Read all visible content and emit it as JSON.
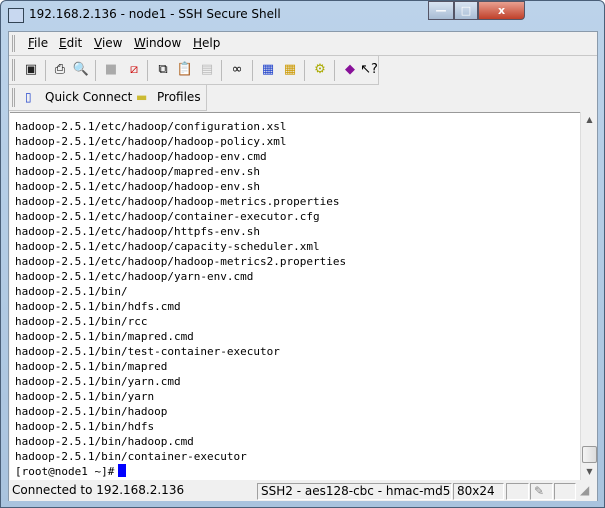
{
  "window": {
    "title": "192.168.2.136 - node1 - SSH Secure Shell",
    "minimize": "—",
    "maximize": "□",
    "close": "x"
  },
  "menu": [
    {
      "label": "File",
      "key": "F",
      "rest": "ile"
    },
    {
      "label": "Edit",
      "key": "E",
      "rest": "dit"
    },
    {
      "label": "View",
      "key": "V",
      "rest": "iew"
    },
    {
      "label": "Window",
      "key": "W",
      "rest": "indow"
    },
    {
      "label": "Help",
      "key": "H",
      "rest": "elp"
    }
  ],
  "toolbar": {
    "icons": [
      "save-icon",
      "print-icon",
      "print-preview-icon",
      "disconnect-icon",
      "connect-icon",
      "copy-icon",
      "paste-icon",
      "paste-disabled-icon",
      "find-icon",
      "new-terminal-icon",
      "new-file-transfer-icon",
      "settings-icon",
      "help-book-icon",
      "whats-this-icon"
    ]
  },
  "quickbar": {
    "quick_connect": "Quick Connect",
    "profiles": "Profiles"
  },
  "terminal": {
    "lines": [
      "hadoop-2.5.1/etc/hadoop/configuration.xsl",
      "hadoop-2.5.1/etc/hadoop/hadoop-policy.xml",
      "hadoop-2.5.1/etc/hadoop/hadoop-env.cmd",
      "hadoop-2.5.1/etc/hadoop/mapred-env.sh",
      "hadoop-2.5.1/etc/hadoop/hadoop-env.sh",
      "hadoop-2.5.1/etc/hadoop/hadoop-metrics.properties",
      "hadoop-2.5.1/etc/hadoop/container-executor.cfg",
      "hadoop-2.5.1/etc/hadoop/httpfs-env.sh",
      "hadoop-2.5.1/etc/hadoop/capacity-scheduler.xml",
      "hadoop-2.5.1/etc/hadoop/hadoop-metrics2.properties",
      "hadoop-2.5.1/etc/hadoop/yarn-env.cmd",
      "hadoop-2.5.1/bin/",
      "hadoop-2.5.1/bin/hdfs.cmd",
      "hadoop-2.5.1/bin/rcc",
      "hadoop-2.5.1/bin/mapred.cmd",
      "hadoop-2.5.1/bin/test-container-executor",
      "hadoop-2.5.1/bin/mapred",
      "hadoop-2.5.1/bin/yarn.cmd",
      "hadoop-2.5.1/bin/yarn",
      "hadoop-2.5.1/bin/hadoop",
      "hadoop-2.5.1/bin/hdfs",
      "hadoop-2.5.1/bin/hadoop.cmd",
      "hadoop-2.5.1/bin/container-executor"
    ],
    "prompt": "[root@node1 ~]#",
    "cursor_color": "#0000ff"
  },
  "status": {
    "connection": "Connected to 192.168.2.136",
    "cipher": "SSH2 - aes128-cbc - hmac-md5",
    "size": "80x24"
  }
}
